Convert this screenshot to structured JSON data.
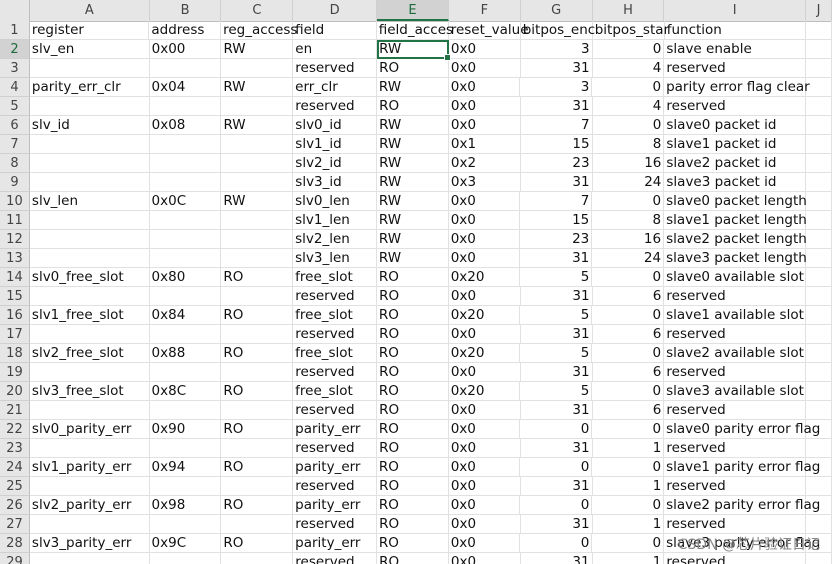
{
  "columns": [
    "A",
    "B",
    "C",
    "D",
    "E",
    "F",
    "G",
    "H",
    "I",
    "J"
  ],
  "rows": [
    [
      "register",
      "address",
      "reg_access",
      "field",
      "field_acces",
      "reset_value",
      "bitpos_enc",
      "bitpos_star",
      "function",
      ""
    ],
    [
      "slv_en",
      "0x00",
      "RW",
      "en",
      "RW",
      "0x0",
      "3",
      "0",
      "slave enable",
      ""
    ],
    [
      "",
      "",
      "",
      "reserved",
      "RO",
      "0x0",
      "31",
      "4",
      "reserved",
      ""
    ],
    [
      "parity_err_clr",
      "0x04",
      "RW",
      "err_clr",
      "RW",
      "0x0",
      "3",
      "0",
      "parity error flag clear",
      ""
    ],
    [
      "",
      "",
      "",
      "reserved",
      "RO",
      "0x0",
      "31",
      "4",
      "reserved",
      ""
    ],
    [
      "slv_id",
      "0x08",
      "RW",
      "slv0_id",
      "RW",
      "0x0",
      "7",
      "0",
      "slave0 packet id",
      ""
    ],
    [
      "",
      "",
      "",
      "slv1_id",
      "RW",
      "0x1",
      "15",
      "8",
      "slave1 packet id",
      ""
    ],
    [
      "",
      "",
      "",
      "slv2_id",
      "RW",
      "0x2",
      "23",
      "16",
      "slave2 packet id",
      ""
    ],
    [
      "",
      "",
      "",
      "slv3_id",
      "RW",
      "0x3",
      "31",
      "24",
      "slave3 packet id",
      ""
    ],
    [
      "slv_len",
      "0x0C",
      "RW",
      "slv0_len",
      "RW",
      "0x0",
      "7",
      "0",
      "slave0 packet length",
      ""
    ],
    [
      "",
      "",
      "",
      "slv1_len",
      "RW",
      "0x0",
      "15",
      "8",
      "slave1 packet length",
      ""
    ],
    [
      "",
      "",
      "",
      "slv2_len",
      "RW",
      "0x0",
      "23",
      "16",
      "slave2 packet length",
      ""
    ],
    [
      "",
      "",
      "",
      "slv3_len",
      "RW",
      "0x0",
      "31",
      "24",
      "slave3 packet length",
      ""
    ],
    [
      "slv0_free_slot",
      "0x80",
      "RO",
      "free_slot",
      "RO",
      "0x20",
      "5",
      "0",
      "slave0 available slot",
      ""
    ],
    [
      "",
      "",
      "",
      "reserved",
      "RO",
      "0x0",
      "31",
      "6",
      "reserved",
      ""
    ],
    [
      "slv1_free_slot",
      "0x84",
      "RO",
      "free_slot",
      "RO",
      "0x20",
      "5",
      "0",
      "slave1 available slot",
      ""
    ],
    [
      "",
      "",
      "",
      "reserved",
      "RO",
      "0x0",
      "31",
      "6",
      "reserved",
      ""
    ],
    [
      "slv2_free_slot",
      "0x88",
      "RO",
      "free_slot",
      "RO",
      "0x20",
      "5",
      "0",
      "slave2 available slot",
      ""
    ],
    [
      "",
      "",
      "",
      "reserved",
      "RO",
      "0x0",
      "31",
      "6",
      "reserved",
      ""
    ],
    [
      "slv3_free_slot",
      "0x8C",
      "RO",
      "free_slot",
      "RO",
      "0x20",
      "5",
      "0",
      "slave3 available slot",
      ""
    ],
    [
      "",
      "",
      "",
      "reserved",
      "RO",
      "0x0",
      "31",
      "6",
      "reserved",
      ""
    ],
    [
      "slv0_parity_err",
      "0x90",
      "RO",
      "parity_err",
      "RO",
      "0x0",
      "0",
      "0",
      "slave0 parity error flag",
      ""
    ],
    [
      "",
      "",
      "",
      "reserved",
      "RO",
      "0x0",
      "31",
      "1",
      "reserved",
      ""
    ],
    [
      "slv1_parity_err",
      "0x94",
      "RO",
      "parity_err",
      "RO",
      "0x0",
      "0",
      "0",
      "slave1 parity error flag",
      ""
    ],
    [
      "",
      "",
      "",
      "reserved",
      "RO",
      "0x0",
      "31",
      "1",
      "reserved",
      ""
    ],
    [
      "slv2_parity_err",
      "0x98",
      "RO",
      "parity_err",
      "RO",
      "0x0",
      "0",
      "0",
      "slave2 parity error flag",
      ""
    ],
    [
      "",
      "",
      "",
      "reserved",
      "RO",
      "0x0",
      "31",
      "1",
      "reserved",
      ""
    ],
    [
      "slv3_parity_err",
      "0x9C",
      "RO",
      "parity_err",
      "RO",
      "0x0",
      "0",
      "0",
      "slave3 parity error flag",
      ""
    ],
    [
      "",
      "",
      "",
      "reserved",
      "RO",
      "0x0",
      "31",
      "1",
      "reserved",
      ""
    ]
  ],
  "selected_cell": "E2",
  "watermark": "CSDN @芯片验证日记",
  "colors": {
    "accent": "#217346",
    "header_bg": "#e6e6e6",
    "grid": "#e1e1e1"
  }
}
